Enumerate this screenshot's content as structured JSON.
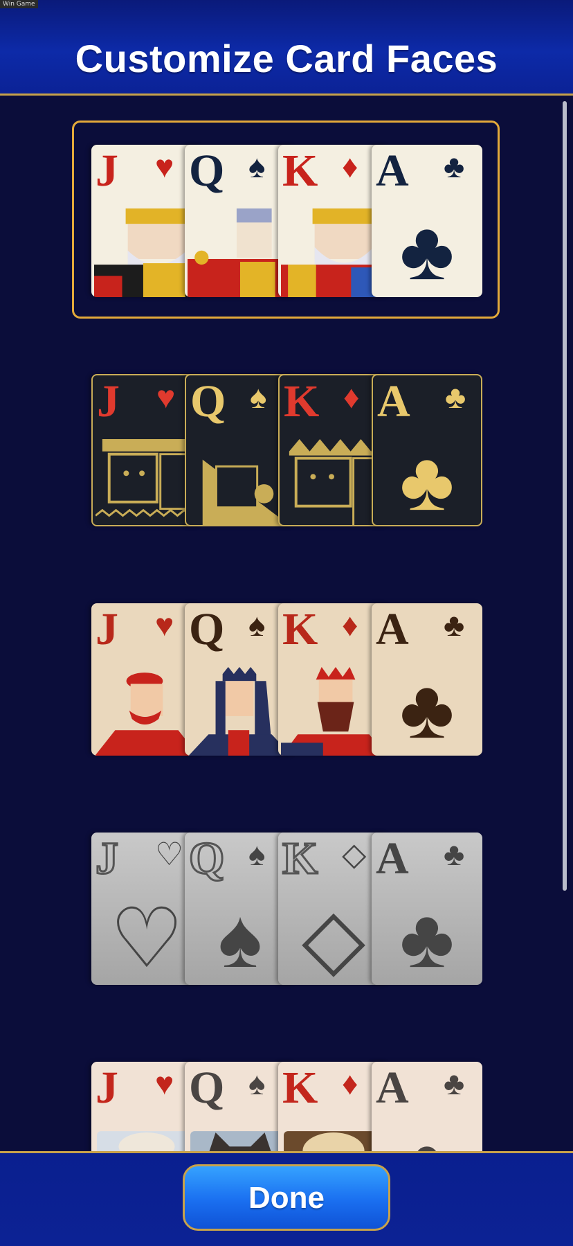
{
  "window_tag": "Win Game",
  "header": {
    "title": "Customize Card Faces"
  },
  "card_sets": [
    {
      "theme": "classic",
      "selected": true,
      "cards": [
        {
          "rank": "J",
          "suit": "♥",
          "color": "red"
        },
        {
          "rank": "Q",
          "suit": "♠",
          "color": "dark"
        },
        {
          "rank": "K",
          "suit": "♦",
          "color": "red"
        },
        {
          "rank": "A",
          "suit": "♣",
          "color": "dark"
        }
      ]
    },
    {
      "theme": "gold",
      "selected": false,
      "cards": [
        {
          "rank": "J",
          "suit": "♥",
          "color": "red"
        },
        {
          "rank": "Q",
          "suit": "♠",
          "color": "dark"
        },
        {
          "rank": "K",
          "suit": "♦",
          "color": "red"
        },
        {
          "rank": "A",
          "suit": "♣",
          "color": "dark"
        }
      ]
    },
    {
      "theme": "folk",
      "selected": false,
      "cards": [
        {
          "rank": "J",
          "suit": "♥",
          "color": "red"
        },
        {
          "rank": "Q",
          "suit": "♠",
          "color": "dark"
        },
        {
          "rank": "K",
          "suit": "♦",
          "color": "red"
        },
        {
          "rank": "A",
          "suit": "♣",
          "color": "dark"
        }
      ]
    },
    {
      "theme": "grey",
      "selected": false,
      "cards": [
        {
          "rank": "J",
          "suit": "♡",
          "color": "outline"
        },
        {
          "rank": "Q",
          "suit": "♠",
          "color": "dark"
        },
        {
          "rank": "K",
          "suit": "◇",
          "color": "outline"
        },
        {
          "rank": "A",
          "suit": "♣",
          "color": "dark"
        }
      ]
    },
    {
      "theme": "pets",
      "selected": false,
      "cards": [
        {
          "rank": "J",
          "suit": "♥",
          "color": "red"
        },
        {
          "rank": "Q",
          "suit": "♠",
          "color": "dark"
        },
        {
          "rank": "K",
          "suit": "♦",
          "color": "red"
        },
        {
          "rank": "A",
          "suit": "♣",
          "color": "dark"
        }
      ]
    }
  ],
  "colors": {
    "accent_gold": "#c8a24a",
    "selected_frame": "#e3a93a",
    "button_blue": "#1a6ff0"
  },
  "footer": {
    "done_label": "Done"
  }
}
